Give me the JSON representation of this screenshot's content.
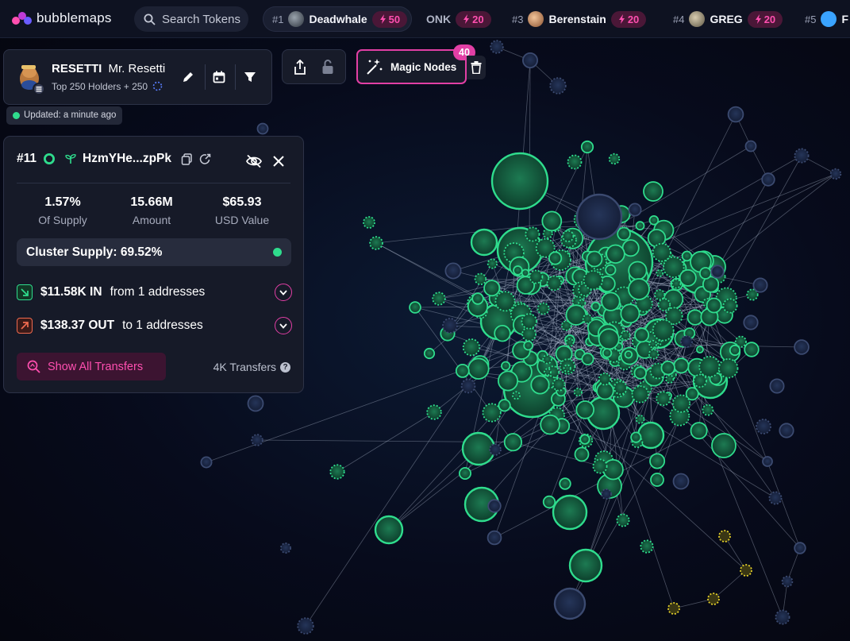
{
  "app": {
    "logo_text": "bubblemaps"
  },
  "search": {
    "placeholder": "Search Tokens"
  },
  "tabs": [
    {
      "rank": "#1",
      "name": "Deadwhale",
      "badge": "50",
      "active": true
    },
    {
      "rank": "",
      "name": "ONK",
      "badge": "20"
    },
    {
      "rank": "#3",
      "name": "Berenstain",
      "badge": "20"
    },
    {
      "rank": "#4",
      "name": "GREG",
      "badge": "20"
    },
    {
      "rank": "#5",
      "name": "F",
      "badge": ""
    }
  ],
  "token": {
    "symbol": "RESETTI",
    "name": "Mr. Resetti",
    "holders": "Top 250 Holders + 250",
    "updated": "Updated: a minute ago"
  },
  "magic_nodes": {
    "label": "Magic Nodes",
    "count": "40"
  },
  "address": {
    "rank": "#11",
    "short": "HzmYHe...zpPk",
    "stats": [
      {
        "value": "1.57%",
        "label": "Of Supply"
      },
      {
        "value": "15.66M",
        "label": "Amount"
      },
      {
        "value": "$65.93",
        "label": "USD Value"
      }
    ],
    "cluster": "Cluster Supply: 69.52%",
    "in_amount": "$11.58K IN",
    "in_text": "from 1 addresses",
    "out_amount": "$138.37 OUT",
    "out_text": "to 1 addresses",
    "show_all": "Show All Transfers",
    "transfers": "4K Transfers"
  },
  "colors": {
    "accent": "#e23fa5",
    "green": "#2fdc8d",
    "node_dark": "#1c2a4f",
    "yellow": "#e6d12a",
    "orange": "#f06a4f"
  }
}
